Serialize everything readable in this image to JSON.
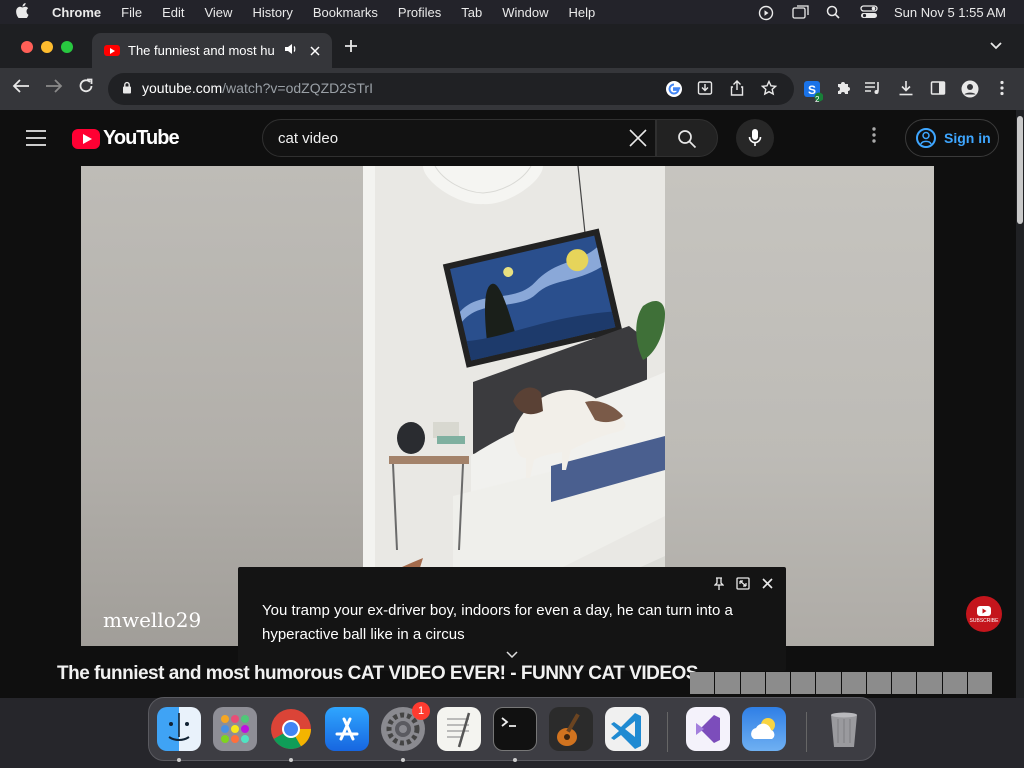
{
  "menubar": {
    "app_name": "Chrome",
    "items": [
      "File",
      "Edit",
      "View",
      "History",
      "Bookmarks",
      "Profiles",
      "Tab",
      "Window",
      "Help"
    ],
    "clock": "Sun Nov 5  1:55 AM"
  },
  "browser": {
    "tab_title": "The funniest and most hu",
    "url_host": "youtube.com",
    "url_path": "/watch?v=odZQZD2STrI",
    "extension_badge": "2"
  },
  "youtube": {
    "search_query": "cat video",
    "sign_in_label": "Sign in",
    "video_watermark": "mwello29",
    "caption_line": "You tramp your ex-driver boy, indoors for even a day, he can turn into a hyperactive ball like in a circus",
    "video_title": "The funniest and most humorous CAT VIDEO EVER! - FUNNY CAT VIDEOS",
    "subscribe_label": "SUBSCRIBE"
  },
  "dock": {
    "settings_badge": "1",
    "apps": [
      "finder-icon",
      "launchpad-icon",
      "chrome-icon",
      "app-store-icon",
      "system-settings-icon",
      "textedit-icon",
      "terminal-icon",
      "garageband-icon",
      "vscode-icon",
      "visual-studio-icon",
      "weather-icon",
      "trash-icon"
    ]
  },
  "colors": {
    "youtube_red": "#ff0033",
    "link_blue": "#3ea6ff",
    "page_bg": "#0f0f0f"
  }
}
